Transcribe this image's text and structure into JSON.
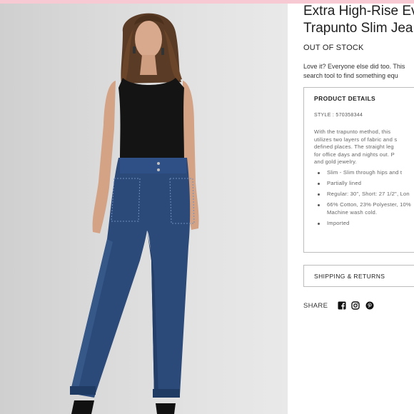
{
  "product": {
    "title_line1": "Extra High-Rise Ev",
    "title_line2": "Trapunto Slim Jea",
    "stock_status": "OUT OF STOCK",
    "blurb_line1": "Love it? Everyone else did too. This",
    "blurb_line2": "search tool to find something equ",
    "image_alt_icon": "model-wearing-jeans-photo"
  },
  "details": {
    "heading": "PRODUCT DETAILS",
    "style_number": "STYLE : 570358344",
    "description_lines": [
      "With the trapunto method, this",
      "utilizes two layers of fabric and s",
      "defined places. The straight leg",
      "for office days and nights out. P",
      "and gold jewelry."
    ],
    "bullets": [
      {
        "line1": "Slim - Slim through hips and t",
        "line2": ""
      },
      {
        "line1": "Partially lined",
        "line2": ""
      },
      {
        "line1": "Regular: 30\", Short: 27 1/2\", Lon",
        "line2": ""
      },
      {
        "line1": "66% Cotton, 23% Polyester, 10%",
        "line2": "Machine wash cold."
      },
      {
        "line1": "Imported",
        "line2": ""
      }
    ]
  },
  "shipping": {
    "label": "SHIPPING & RETURNS"
  },
  "share": {
    "label": "SHARE",
    "icons": [
      "facebook-icon",
      "instagram-icon",
      "pinterest-icon"
    ]
  },
  "colors": {
    "accent_bar": "#f6c9d3",
    "denim": "#2b4a7a",
    "border": "#bdbdbd"
  }
}
